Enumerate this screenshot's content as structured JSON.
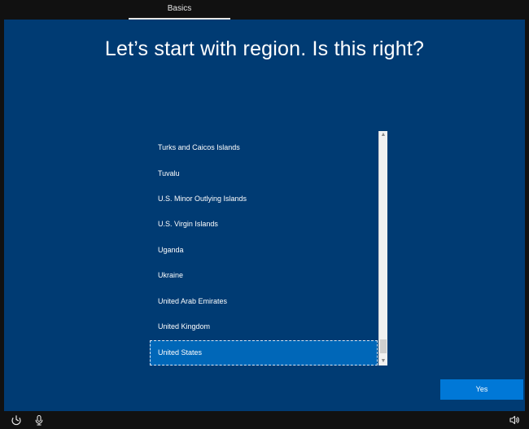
{
  "header": {
    "active_tab": "Basics"
  },
  "main": {
    "title": "Let’s start with region. Is this right?",
    "region_list": {
      "items": [
        "Turks and Caicos Islands",
        "Tuvalu",
        "U.S. Minor Outlying Islands",
        "U.S. Virgin Islands",
        "Uganda",
        "Ukraine",
        "United Arab Emirates",
        "United Kingdom",
        "United States"
      ],
      "selected": "United States"
    },
    "yes_label": "Yes"
  },
  "icons": {
    "ease_of_access": "ease-of-access-icon",
    "microphone": "microphone-icon",
    "volume": "volume-icon"
  },
  "colors": {
    "panel_background": "#003b73",
    "selected_item": "#0067b8",
    "button_accent": "#0078d7",
    "chrome_background": "#111111"
  }
}
